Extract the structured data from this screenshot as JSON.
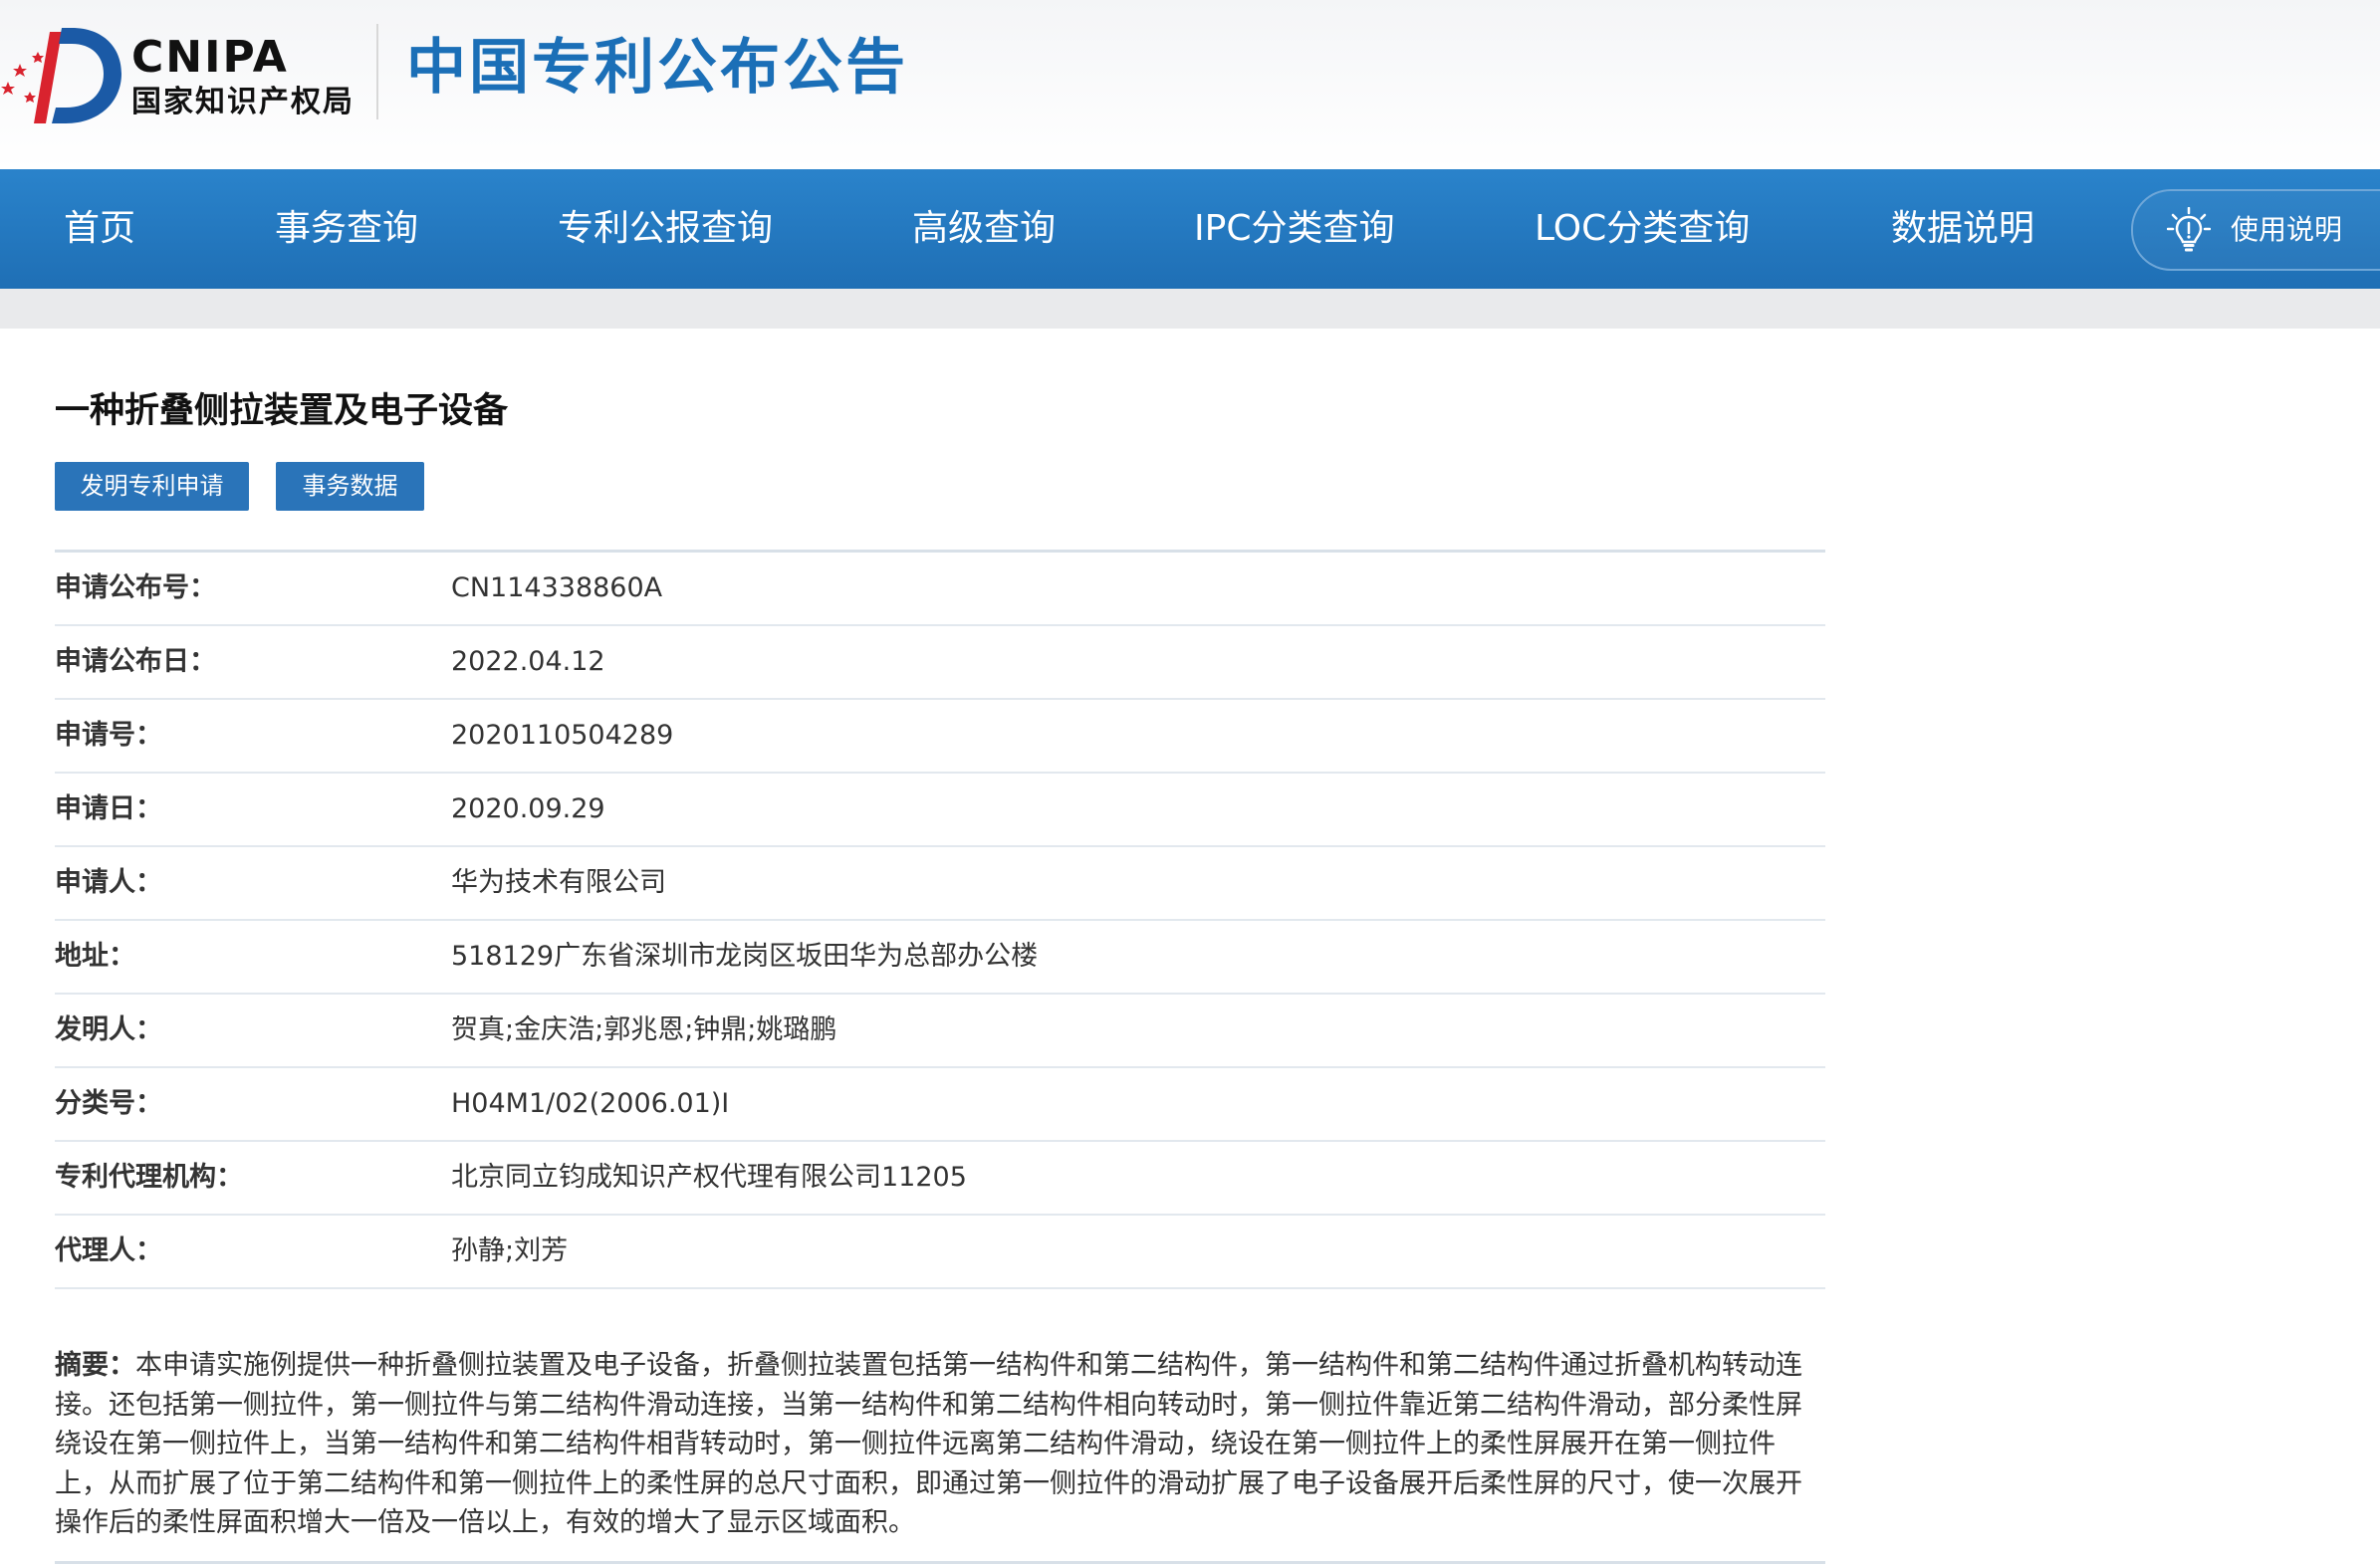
{
  "header": {
    "logo_text": "CNIPA",
    "logo_subtitle": "国家知识产权局",
    "site_title": "中国专利公布公告"
  },
  "nav": {
    "items": [
      {
        "label": "首页"
      },
      {
        "label": "事务查询"
      },
      {
        "label": "专利公报查询"
      },
      {
        "label": "高级查询"
      },
      {
        "label": "IPC分类查询"
      },
      {
        "label": "LOC分类查询"
      },
      {
        "label": "数据说明"
      }
    ],
    "help_label": "使用说明",
    "help_icon": "lightbulb-icon"
  },
  "patent": {
    "title": "一种折叠侧拉装置及电子设备",
    "tags": [
      {
        "label": "发明专利申请"
      },
      {
        "label": "事务数据"
      }
    ],
    "fields": [
      {
        "label": "申请公布号：",
        "value": "CN114338860A"
      },
      {
        "label": "申请公布日：",
        "value": "2022.04.12"
      },
      {
        "label": "申请号：",
        "value": "2020110504289"
      },
      {
        "label": "申请日：",
        "value": "2020.09.29"
      },
      {
        "label": "申请人：",
        "value": "华为技术有限公司"
      },
      {
        "label": "地址：",
        "value": "518129广东省深圳市龙岗区坂田华为总部办公楼"
      },
      {
        "label": "发明人：",
        "value": "贺真;金庆浩;郭兆恩;钟鼎;姚璐鹏"
      },
      {
        "label": "分类号：",
        "value": "H04M1/02(2006.01)I"
      },
      {
        "label": "专利代理机构：",
        "value": "北京同立钧成知识产权代理有限公司11205"
      },
      {
        "label": "代理人：",
        "value": "孙静;刘芳"
      }
    ],
    "abstract_label": "摘要：",
    "abstract_text": "本申请实施例提供一种折叠侧拉装置及电子设备，折叠侧拉装置包括第一结构件和第二结构件，第一结构件和第二结构件通过折叠机构转动连接。还包括第一侧拉件，第一侧拉件与第二结构件滑动连接，当第一结构件和第二结构件相向转动时，第一侧拉件靠近第二结构件滑动，部分柔性屏绕设在第一侧拉件上，当第一结构件和第二结构件相背转动时，第一侧拉件远离第二结构件滑动，绕设在第一侧拉件上的柔性屏展开在第一侧拉件上，从而扩展了位于第二结构件和第一侧拉件上的柔性屏的总尺寸面积，即通过第一侧拉件的滑动扩展了电子设备展开后柔性屏的尺寸，使一次展开操作后的柔性屏面积增大一倍及一倍以上，有效的增大了显示区域面积。"
  },
  "colors": {
    "brand_blue": "#1b6fb7",
    "nav_blue": "#1f6fb5",
    "tag_blue": "#2a74b9",
    "logo_red": "#d9232e"
  }
}
